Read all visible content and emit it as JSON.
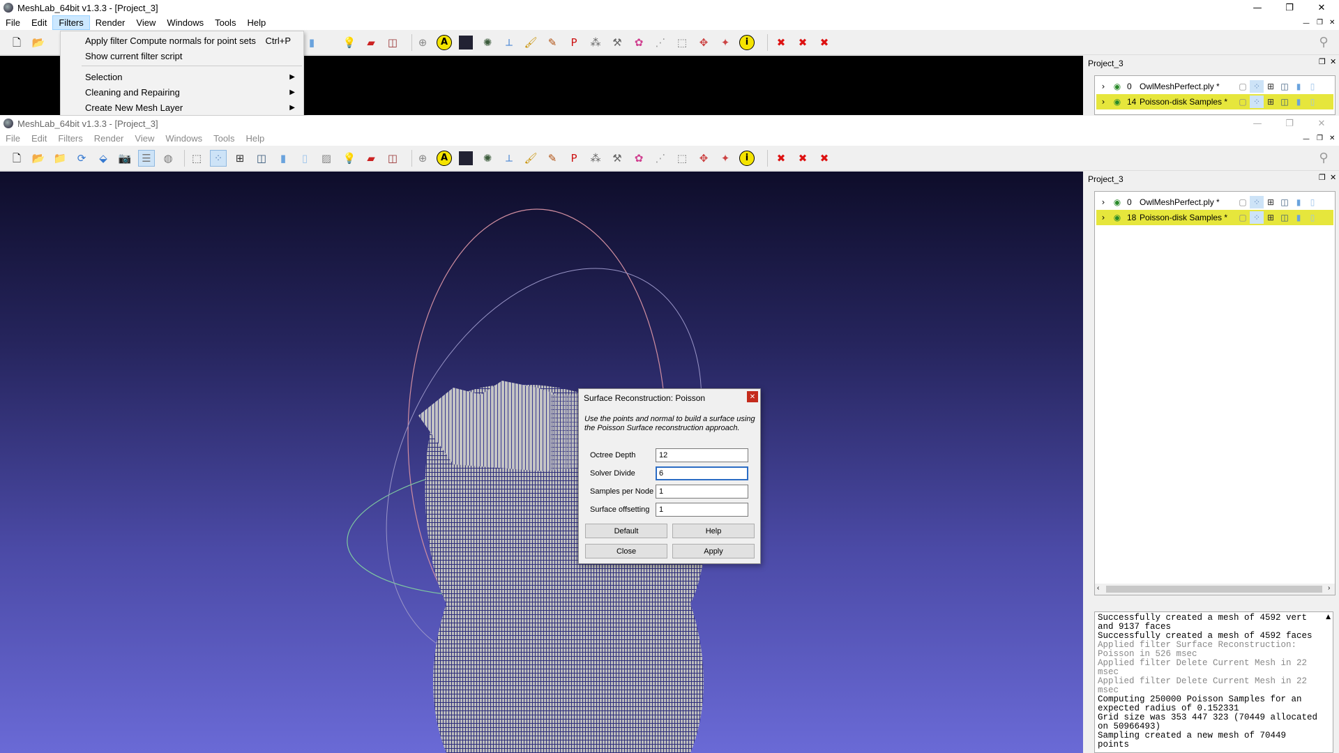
{
  "bg_window": {
    "title": "MeshLab_64bit v1.3.3 - [Project_3]",
    "menu": [
      "File",
      "Edit",
      "Filters",
      "Render",
      "View",
      "Windows",
      "Tools",
      "Help"
    ],
    "active_menu": "Filters",
    "project_panel_title": "Project_3",
    "layers": [
      {
        "index": "0",
        "name": "OwlMeshPerfect.ply *",
        "selected": false
      },
      {
        "index": "14",
        "name": "Poisson-disk Samples *",
        "selected": true
      }
    ]
  },
  "filters_menu": {
    "items": [
      {
        "label": "Apply filter Compute normals for point sets",
        "shortcut": "Ctrl+P"
      },
      {
        "label": "Show current filter script",
        "shortcut": ""
      },
      {
        "label": "Selection",
        "submenu": true
      },
      {
        "label": "Cleaning and Repairing",
        "submenu": true
      },
      {
        "label": "Create New Mesh Layer",
        "submenu": true
      }
    ]
  },
  "fg_window": {
    "title": "MeshLab_64bit v1.3.3 - [Project_3]",
    "menu": [
      "File",
      "Edit",
      "Filters",
      "Render",
      "View",
      "Windows",
      "Tools",
      "Help"
    ],
    "project_panel_title": "Project_3",
    "layers": [
      {
        "index": "0",
        "name": "OwlMeshPerfect.ply *",
        "selected": false
      },
      {
        "index": "18",
        "name": "Poisson-disk Samples *",
        "selected": true
      }
    ]
  },
  "dialog": {
    "title": "Surface Reconstruction: Poisson",
    "description": "Use the points and normal to build a surface using the Poisson Surface reconstruction approach.",
    "fields": [
      {
        "label": "Octree Depth",
        "value": "12"
      },
      {
        "label": "Solver Divide",
        "value": "6"
      },
      {
        "label": "Samples per Node",
        "value": "1"
      },
      {
        "label": "Surface offsetting",
        "value": "1"
      }
    ],
    "buttons": {
      "default": "Default",
      "help": "Help",
      "close": "Close",
      "apply": "Apply"
    }
  },
  "log": [
    {
      "text": "Successfully created a mesh of 4592 vert and 9137 faces",
      "grey": false
    },
    {
      "text": "Successfully created a mesh of 4592 faces",
      "grey": false
    },
    {
      "text": "Applied filter Surface Reconstruction: Poisson in 526 msec",
      "grey": true
    },
    {
      "text": "Applied filter Delete Current Mesh in 22 msec",
      "grey": true
    },
    {
      "text": "Applied filter Delete Current Mesh in 22 msec",
      "grey": true
    },
    {
      "text": "Computing 250000 Poisson Samples for an expected radius of 0.152331",
      "grey": false
    },
    {
      "text": "Grid size was 353 447 323 (70449 allocated on 50966493)",
      "grey": false
    },
    {
      "text": "Sampling created a new mesh of 70449 points",
      "grey": false
    }
  ],
  "window_controls": {
    "minimize": "—",
    "maximize": "▢",
    "close": "✕"
  },
  "colors": {
    "selected_layer": "#e6e63c",
    "viewport_top": "#0e0d2a",
    "viewport_bottom": "#6a6ad6",
    "close_red": "#c42b1c"
  }
}
